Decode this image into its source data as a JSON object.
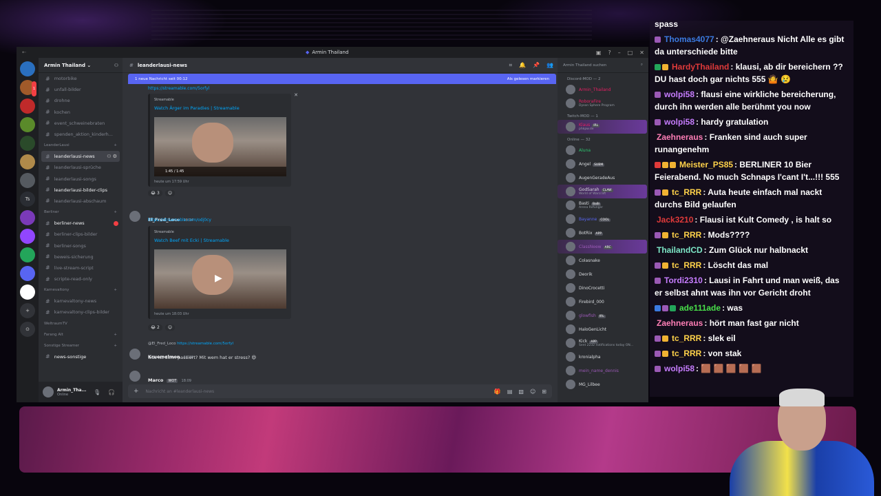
{
  "discord": {
    "window_title": "Armin Thailand",
    "servers": [
      {
        "color": "#2a6fbf"
      },
      {
        "color": "#a05a2a",
        "badge": "1"
      },
      {
        "color": "#c02a2a"
      },
      {
        "color": "#5a8a2a"
      },
      {
        "color": "#2a4a2a"
      },
      {
        "color": "#b08a4a"
      },
      {
        "color": "#555a60"
      },
      {
        "color": "#2a2d33",
        "label": "Ts"
      },
      {
        "color": "#7a3ab8"
      },
      {
        "color": "#9146ff"
      },
      {
        "color": "#23a55a"
      },
      {
        "color": "#5865f2"
      },
      {
        "color": "#ffffff"
      },
      {
        "color": "#313338",
        "label": "+"
      },
      {
        "color": "#313338",
        "label": "⊙"
      }
    ],
    "guild_name": "Armin Thailand",
    "channels_top": [
      "motorbike",
      "unfall-bilder",
      "drohne",
      "kochen",
      "event_schweinebraten",
      "spenden_aktion_kinderh..."
    ],
    "cat_leanderlausi": "LeanderLausi",
    "channels_leander": [
      "leanderlausi-news",
      "leanderlausi-sprüche",
      "leanderlausi-songs",
      "leanderlausi-bilder-clips",
      "leanderlausi-abschaum"
    ],
    "cat_berliner": "Berliner",
    "channels_berliner": [
      "berliner-news",
      "berliner-clips-bilder",
      "berliner-songs",
      "beweis-sicherung",
      "live-stream-script",
      "scripte-read-only"
    ],
    "cat_karneval": "Karnevaltony",
    "channels_karneval": [
      "karnevaltony-news",
      "karnevaltony-clips-bilder"
    ],
    "cat_weltraum": "WeltraumTV",
    "cat_farang": "Farang Alt",
    "cat_sonstige": "Sonstige Streamer",
    "channels_sonstige": [
      "news-sonstige"
    ],
    "user_name": "Armin_Tha...",
    "user_status": "Online",
    "channel_header": "leanderlausi-news",
    "new_messages": "1 neue Nachricht seit 00:12",
    "mark_read": "Als gelesen markieren",
    "link1": "https://streamable.com/5orfyl",
    "embed1_provider": "Streamable",
    "embed1_title": "Watch Ärger im Paradies | Streamable",
    "embed1_time": "1:45 / 1:45",
    "embed1_footer": "heute um 17:59 Uhr",
    "react1": "3",
    "msg2_author": "El_Fred_Loco",
    "msg2_time": "18:04",
    "link2": "https://streamable.com/odj0cy",
    "embed2_provider": "Streamable",
    "embed2_title": "Watch Beef mit Ecki | Streamable",
    "embed2_footer": "heute um 18:03 Uhr",
    "react2": "2",
    "reply_author": "@El_Fred_Loco",
    "reply_link": "https://streamable.com/5orfyl",
    "msg3_author": "Kruemelmon",
    "msg3_time": "18:08",
    "msg3_text": "was ist denn passiert? Mit wem hat er stress?",
    "msg4_author": "Marco",
    "msg4_tag": "WOT",
    "msg4_time": "18:09",
    "composer_placeholder": "Nachricht an #leanderlausi-news",
    "member_search": "Armin Thailand suchen",
    "cat_discord_mod": "Discord-MOD — 2",
    "cat_twitch_mod": "Twitch-MOD — 1",
    "cat_online": "Online — 32",
    "mods": [
      {
        "name": "Armin_Thailand",
        "color": "#e91e63",
        "sub": ""
      },
      {
        "name": "RoboraFire",
        "color": "#e91e63",
        "sub": "Dyson Sphere Program"
      }
    ],
    "twitch_mods": [
      {
        "name": "Klaus",
        "color": "#e91e63",
        "sub": "phkpw.de",
        "tag": "IRL"
      }
    ],
    "members": [
      {
        "name": "Aluna",
        "color": "#2dc770",
        "sub": ""
      },
      {
        "name": "Angel",
        "color": "#dbdee1",
        "sub": "",
        "tag": "SUBM"
      },
      {
        "name": "AugenGeradeAus",
        "color": "#dbdee1",
        "sub": ""
      },
      {
        "name": "GodSarah",
        "color": "#dbdee1",
        "sub": "World of Warcraft",
        "tag": "CLAW"
      },
      {
        "name": "Basti",
        "color": "#dbdee1",
        "sub": "Arena Refunger",
        "tag": "BaBi"
      },
      {
        "name": "Bayanne",
        "color": "#5865f2",
        "sub": "",
        "tag": "COOL"
      },
      {
        "name": "BotRix",
        "color": "#dbdee1",
        "sub": "",
        "tag": "APP"
      },
      {
        "name": "ClassNeew",
        "color": "#9b59b6",
        "sub": "",
        "tag": "ARC"
      },
      {
        "name": "Colasnake",
        "color": "#dbdee1",
        "sub": ""
      },
      {
        "name": "Deorik",
        "color": "#dbdee1",
        "sub": ""
      },
      {
        "name": "DinoCrocetti",
        "color": "#dbdee1",
        "sub": ""
      },
      {
        "name": "Firebird_000",
        "color": "#dbdee1",
        "sub": ""
      },
      {
        "name": "glowfish",
        "color": "#9b59b6",
        "sub": "",
        "tag": "IRL"
      },
      {
        "name": "HaloGenLicht",
        "color": "#dbdee1",
        "sub": ""
      },
      {
        "name": "Kick",
        "color": "#dbdee1",
        "sub": "Sent 2232 notifications today ON...",
        "tag": "APP"
      },
      {
        "name": "kronialpha",
        "color": "#dbdee1",
        "sub": ""
      },
      {
        "name": "mein_name_dennis",
        "color": "#9b59b6",
        "sub": ""
      },
      {
        "name": "MG_Lilbee",
        "color": "#dbdee1",
        "sub": ""
      }
    ]
  },
  "twitch_chat": [
    {
      "user": "",
      "ucolor": "#ffffff",
      "text": "spass",
      "badges": []
    },
    {
      "user": "Thomas4077",
      "ucolor": "#3b7ae0",
      "text": ": @Zaehneraus Nicht Alle es gibt da unterschiede bitte",
      "badges": [
        "#9b59b6"
      ]
    },
    {
      "user": "HardyThailand",
      "ucolor": "#e03a3a",
      "text": ": klausi, ab dir bereichern ?? DU hast doch gar nichts 555 🤷 😢",
      "badges": [
        "#23a55a",
        "#f0b232"
      ]
    },
    {
      "user": "wolpi58",
      "ucolor": "#c77dff",
      "text": ": flausi eine wirkliche bereicherung, durch ihn werden alle berühmt you now",
      "badges": [
        "#9b59b6"
      ]
    },
    {
      "user": "wolpi58",
      "ucolor": "#c77dff",
      "text": ": hardy gratulation",
      "badges": [
        "#9b59b6"
      ]
    },
    {
      "user": "Zaehneraus",
      "ucolor": "#ff7eb6",
      "text": ": Franken sind auch super runangenehm",
      "badges": []
    },
    {
      "user": "Meister_PS85",
      "ucolor": "#ffd24a",
      "text": ": BERLINER 10 Bier Feierabend. No much Schnaps I'cant I't...!!! 555",
      "badges": [
        "#e03a3a",
        "#f0b232",
        "#f0b232"
      ]
    },
    {
      "user": "tc_RRR",
      "ucolor": "#ffd24a",
      "text": ": Auta heute einfach mal nackt durchs Bild gelaufen",
      "badges": [
        "#9b59b6",
        "#f0b232"
      ]
    },
    {
      "user": "Jack3210",
      "ucolor": "#e03a3a",
      "text": ": Flausi ist Kult Comedy , is halt so",
      "badges": []
    },
    {
      "user": "tc_RRR",
      "ucolor": "#ffd24a",
      "text": ": Mods????",
      "badges": [
        "#9b59b6",
        "#f0b232"
      ]
    },
    {
      "user": "ThailandCD",
      "ucolor": "#7ee8c8",
      "text": ": Zum Glück nur halbnackt",
      "badges": []
    },
    {
      "user": "tc_RRR",
      "ucolor": "#ffd24a",
      "text": ": Löscht das mal",
      "badges": [
        "#9b59b6",
        "#f0b232"
      ]
    },
    {
      "user": "Tordi2310",
      "ucolor": "#c77dff",
      "text": ": Lausi in Fahrt und man weiß, das er selbst ahnt was ihn vor Gericht droht",
      "badges": [
        "#9b59b6"
      ]
    },
    {
      "user": "ade111ade",
      "ucolor": "#49e04a",
      "text": ": was",
      "badges": [
        "#3b7ae0",
        "#9b59b6",
        "#23a55a"
      ]
    },
    {
      "user": "Zaehneraus",
      "ucolor": "#ff7eb6",
      "text": ": hört man fast gar nicht",
      "badges": []
    },
    {
      "user": "tc_RRR",
      "ucolor": "#ffd24a",
      "text": ": slek eil",
      "badges": [
        "#9b59b6",
        "#f0b232"
      ]
    },
    {
      "user": "tc_RRR",
      "ucolor": "#ffd24a",
      "text": ": von stak",
      "badges": [
        "#9b59b6",
        "#f0b232"
      ]
    },
    {
      "user": "wolpi58",
      "ucolor": "#c77dff",
      "text": ": 🟫 🟫 🟫 🟫 🟫",
      "badges": [
        "#9b59b6"
      ]
    }
  ]
}
